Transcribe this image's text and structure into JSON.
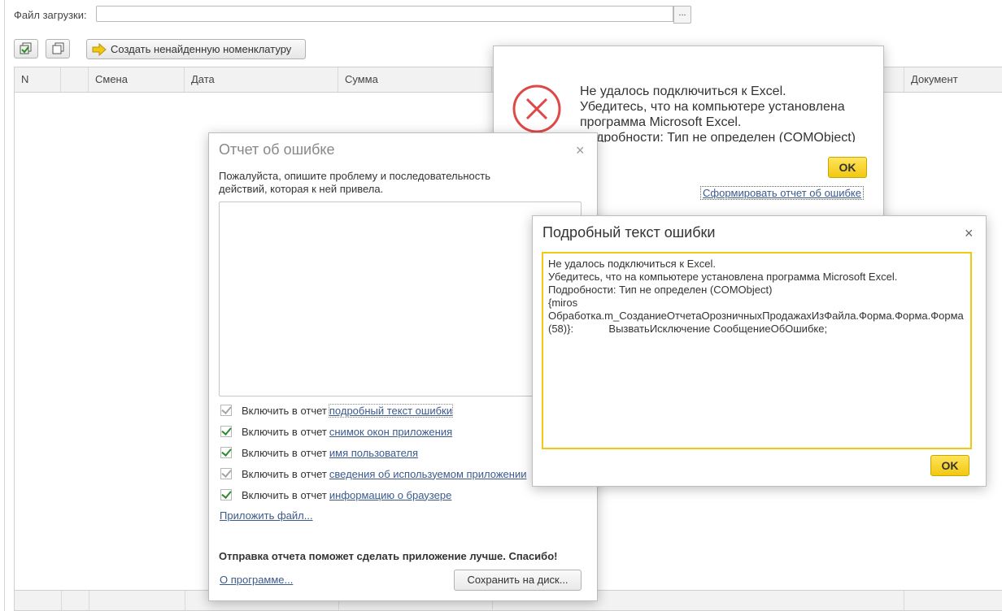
{
  "form": {
    "file_label": "Файл загрузки:",
    "file_value": "",
    "browse_label": "...",
    "create_button": "Создать ненайденную номенклатуру"
  },
  "grid": {
    "columns": [
      "N",
      "",
      "Смена",
      "Дата",
      "Сумма",
      "Документ"
    ]
  },
  "excel_dialog": {
    "message": "Не удалось подключиться к Excel.\nУбедитесь, что на компьютере установлена программа Microsoft Excel.\nПодробности: Тип не определен (COMObject)",
    "ok": "OK",
    "report_link": "Сформировать отчет об ошибке"
  },
  "report_dialog": {
    "title": "Отчет об ошибке",
    "close": "×",
    "description": "Пожалуйста, опишите проблему и последовательность действий, которая к ней привела.",
    "checkboxes": [
      {
        "prefix": "Включить в отчет",
        "link": "подробный текст ошибки",
        "checked": true,
        "dim": true
      },
      {
        "prefix": "Включить в отчет",
        "link": "снимок окон приложения",
        "checked": true,
        "dim": false
      },
      {
        "prefix": "Включить в отчет",
        "link": "имя пользователя",
        "checked": true,
        "dim": false
      },
      {
        "prefix": "Включить в отчет",
        "link": "сведения об используемом приложении",
        "checked": true,
        "dim": true
      },
      {
        "prefix": "Включить в отчет",
        "link": "информацию о браузере",
        "checked": true,
        "dim": false
      }
    ],
    "attach_link": "Приложить файл...",
    "footer_message": "Отправка отчета поможет сделать приложение лучше. Спасибо!",
    "about_link": "О программе...",
    "save_button": "Сохранить на диск..."
  },
  "detail_dialog": {
    "title": "Подробный текст ошибки",
    "close": "×",
    "text": "Не удалось подключиться к Excel.\nУбедитесь, что на компьютере установлена программа Microsoft Excel.\nПодробности: Тип не определен (COMObject)\n{miros\nОбработка.m_СозданиеОтчетаОрозничныхПродажахИзФайла.Форма.Форма.Форма(58)}:            ВызватьИсключение СообщениеОбОшибке;",
    "ok": "OK"
  },
  "colors": {
    "accent_yellow": "#f2c811",
    "error_red": "#e04848",
    "link": "#3b5a8c",
    "check_green": "#2e8b2e"
  }
}
